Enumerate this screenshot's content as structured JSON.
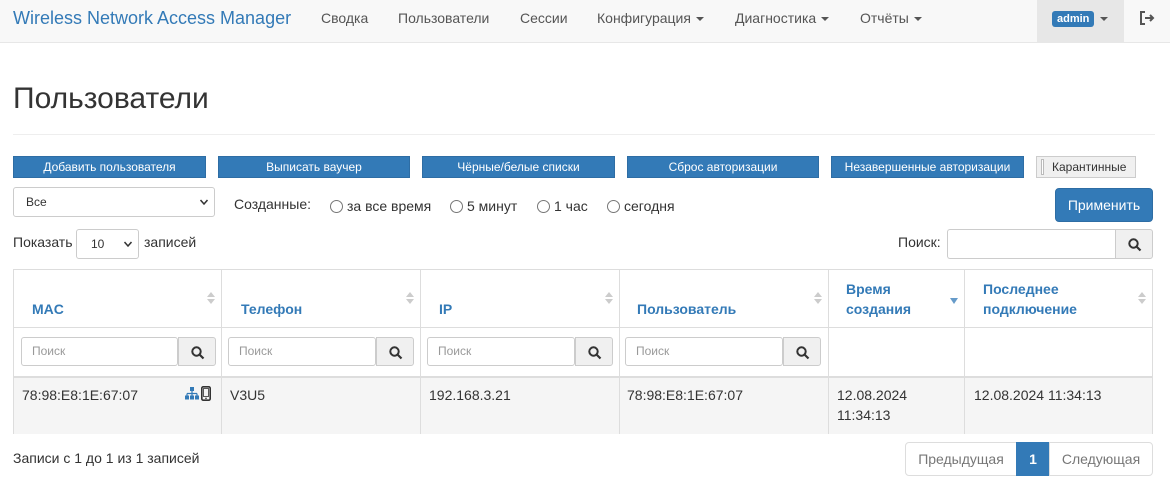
{
  "navbar": {
    "brand": "Wireless Network Access Manager",
    "items": [
      "Сводка",
      "Пользователи",
      "Сессии",
      "Конфигурация",
      "Диагностика",
      "Отчёты"
    ],
    "user": "admin"
  },
  "page": {
    "title": "Пользователи"
  },
  "actions": {
    "add_user": "Добавить пользователя",
    "issue_voucher": "Выписать ваучер",
    "black_white_lists": "Чёрные/белые списки",
    "reset_auth": "Сброс авторизации",
    "incomplete_auth": "Незавершенные авторизации",
    "quarantine": "Карантинные"
  },
  "filters": {
    "select_value": "Все",
    "created_label": "Созданные:",
    "radio_all_time": "за все время",
    "radio_5min": "5 минут",
    "radio_1hour": "1 час",
    "radio_today": "сегодня",
    "apply": "Применить"
  },
  "length": {
    "show": "Показать",
    "value": "10",
    "entries": "записей"
  },
  "search": {
    "label": "Поиск:",
    "value": ""
  },
  "table": {
    "headers": {
      "mac": "MAC",
      "phone": "Телефон",
      "ip": "IP",
      "user": "Пользователь",
      "created_1": "Время",
      "created_2": "создания",
      "last_1": "Последнее",
      "last_2": "подключение"
    },
    "column_search_placeholder": "Поиск",
    "row": {
      "mac": "78:98:E8:1E:67:07",
      "phone": "V3U5",
      "ip": "192.168.3.21",
      "user": "78:98:E8:1E:67:07",
      "created_date": "12.08.2024",
      "created_time": "11:34:13",
      "last_connection": "12.08.2024 11:34:13"
    }
  },
  "footer": {
    "info": "Записи с 1 до 1 из 1 записей",
    "prev": "Предыдущая",
    "page": "1",
    "next": "Следующая"
  },
  "colors": {
    "primary": "#337ab7",
    "navbar_bg": "#f8f8f8"
  },
  "icons": [
    "caret-down-icon",
    "logout-icon",
    "chevron-down-icon",
    "search-icon",
    "sort-icon",
    "sort-desc-icon",
    "network-icon",
    "mobile-icon"
  ]
}
